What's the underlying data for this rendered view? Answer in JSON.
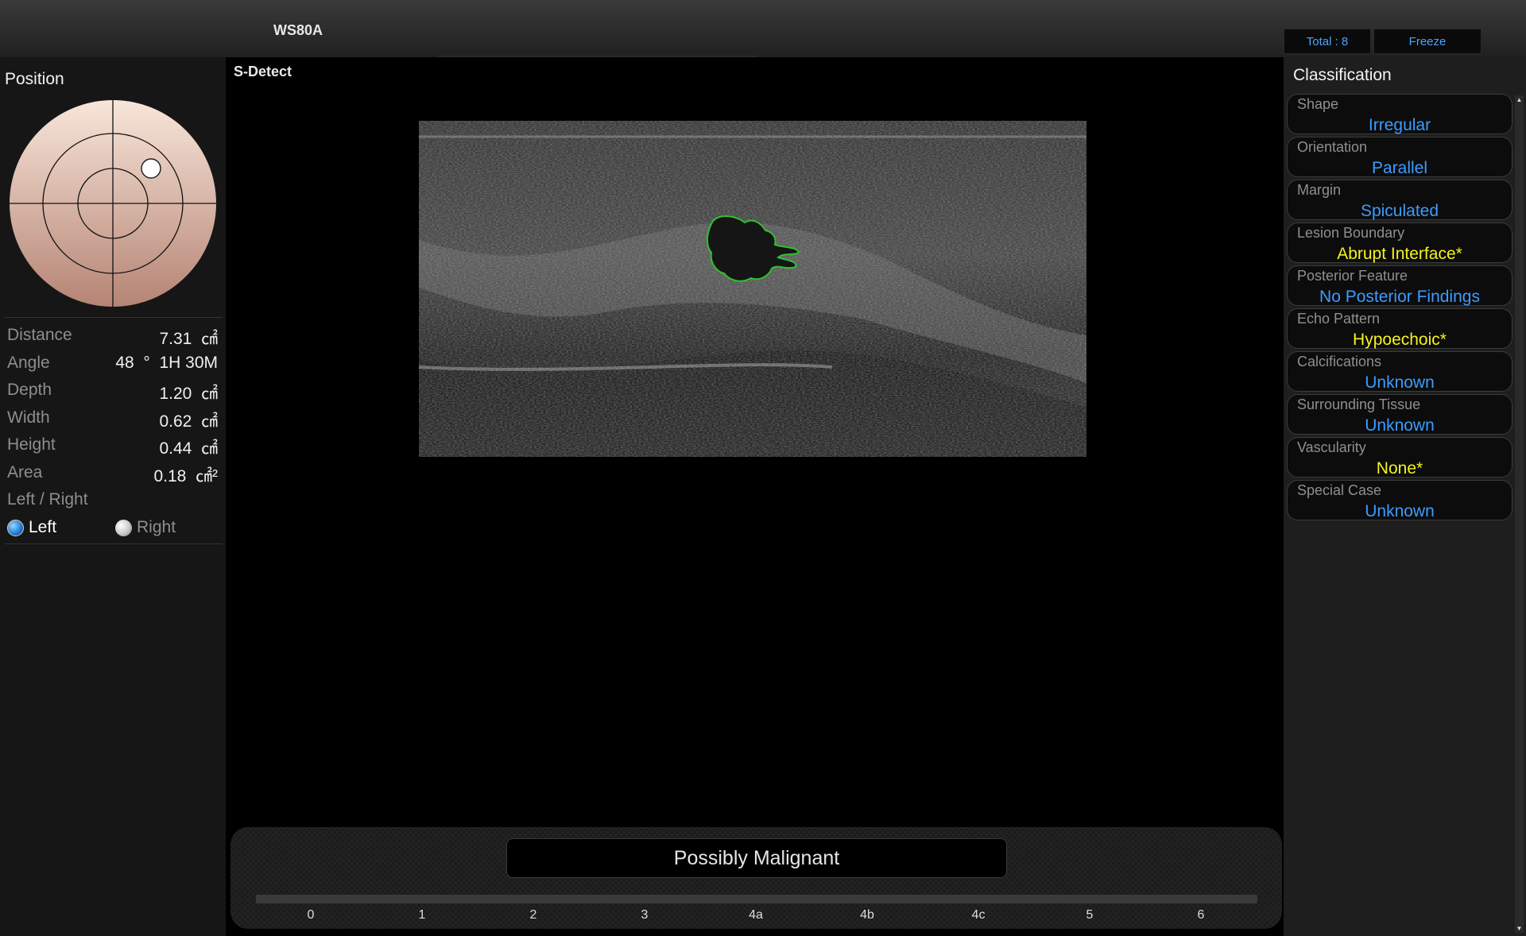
{
  "header": {
    "model": "WS80A",
    "total_label": "Total : 8",
    "freeze_label": "Freeze"
  },
  "left_panel": {
    "position_title": "Position",
    "measurements": [
      {
        "label": "Distance",
        "value": "7.31  ㎠"
      },
      {
        "label": "Angle",
        "value": "48  °  1H 30M"
      },
      {
        "label": "Depth",
        "value": "1.20  ㎠"
      },
      {
        "label": "Width",
        "value": "0.62  ㎠"
      },
      {
        "label": "Height",
        "value": "0.44  ㎠"
      },
      {
        "label": "Area",
        "value": "0.18  ㎠²"
      }
    ],
    "lr_title": "Left / Right",
    "left_label": "Left",
    "right_label": "Right",
    "selected_side": "Left"
  },
  "center": {
    "title": "S-Detect",
    "result": "Possibly Malignant",
    "scale_ticks": [
      "0",
      "1",
      "2",
      "3",
      "4a",
      "4b",
      "4c",
      "5",
      "6"
    ]
  },
  "classification": {
    "title": "Classification",
    "items": [
      {
        "label": "Shape",
        "value": "Irregular",
        "color": "#3c9cff"
      },
      {
        "label": "Orientation",
        "value": "Parallel",
        "color": "#3c9cff"
      },
      {
        "label": "Margin",
        "value": "Spiculated",
        "color": "#3c9cff"
      },
      {
        "label": "Lesion Boundary",
        "value": "Abrupt Interface*",
        "color": "#f3f31e"
      },
      {
        "label": "Posterior Feature",
        "value": "No Posterior Findings",
        "color": "#3c9cff"
      },
      {
        "label": "Echo Pattern",
        "value": "Hypoechoic*",
        "color": "#f3f31e"
      },
      {
        "label": "Calcifications",
        "value": "Unknown",
        "color": "#3c9cff"
      },
      {
        "label": "Surrounding Tissue",
        "value": "Unknown",
        "color": "#3c9cff"
      },
      {
        "label": "Vascularity",
        "value": "None*",
        "color": "#f3f31e"
      },
      {
        "label": "Special Case",
        "value": "Unknown",
        "color": "#3c9cff"
      }
    ]
  },
  "icons": {
    "scroll_up": "scroll-up-arrow-icon",
    "scroll_down": "scroll-down-arrow-icon"
  }
}
